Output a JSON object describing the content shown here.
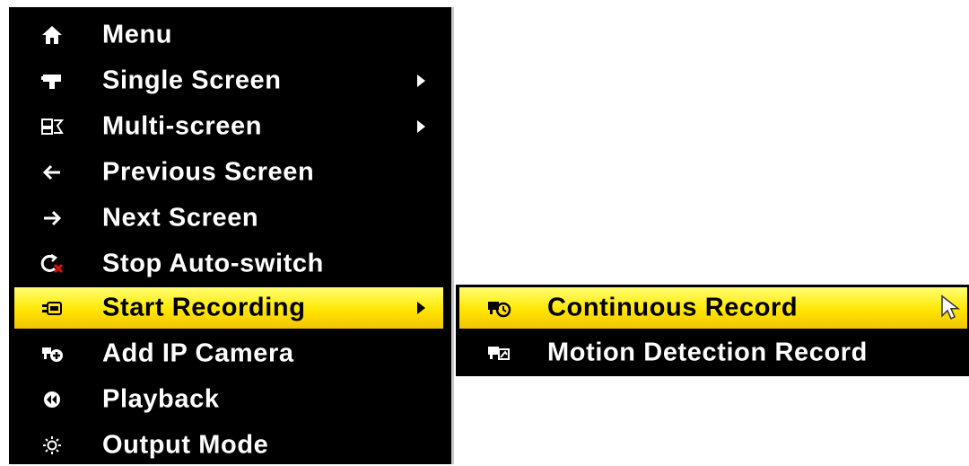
{
  "main_menu": {
    "items": [
      {
        "label": "Menu",
        "icon": "home-icon",
        "has_submenu": false,
        "highlighted": false
      },
      {
        "label": "Single Screen",
        "icon": "camera-icon",
        "has_submenu": true,
        "highlighted": false
      },
      {
        "label": "Multi-screen",
        "icon": "multi-screen-icon",
        "has_submenu": true,
        "highlighted": false
      },
      {
        "label": "Previous Screen",
        "icon": "arrow-left-icon",
        "has_submenu": false,
        "highlighted": false
      },
      {
        "label": "Next Screen",
        "icon": "arrow-right-icon",
        "has_submenu": false,
        "highlighted": false
      },
      {
        "label": "Stop Auto-switch",
        "icon": "stop-auto-switch-icon",
        "has_submenu": false,
        "highlighted": false
      },
      {
        "label": "Start Recording",
        "icon": "recording-icon",
        "has_submenu": true,
        "highlighted": true
      },
      {
        "label": "Add IP Camera",
        "icon": "add-camera-icon",
        "has_submenu": false,
        "highlighted": false
      },
      {
        "label": "Playback",
        "icon": "playback-icon",
        "has_submenu": false,
        "highlighted": false
      },
      {
        "label": "Output Mode",
        "icon": "output-mode-icon",
        "has_submenu": false,
        "highlighted": false
      }
    ]
  },
  "submenu": {
    "items": [
      {
        "label": "Continuous Record",
        "icon": "continuous-record-icon",
        "highlighted": true
      },
      {
        "label": "Motion Detection Record",
        "icon": "motion-detection-icon",
        "highlighted": false
      }
    ]
  },
  "colors": {
    "menu_bg": "#000000",
    "text": "#ffffff",
    "highlight_top": "#ffff73",
    "highlight_bottom": "#f2c400",
    "highlight_text": "#000000",
    "stop_x": "#e01010"
  }
}
